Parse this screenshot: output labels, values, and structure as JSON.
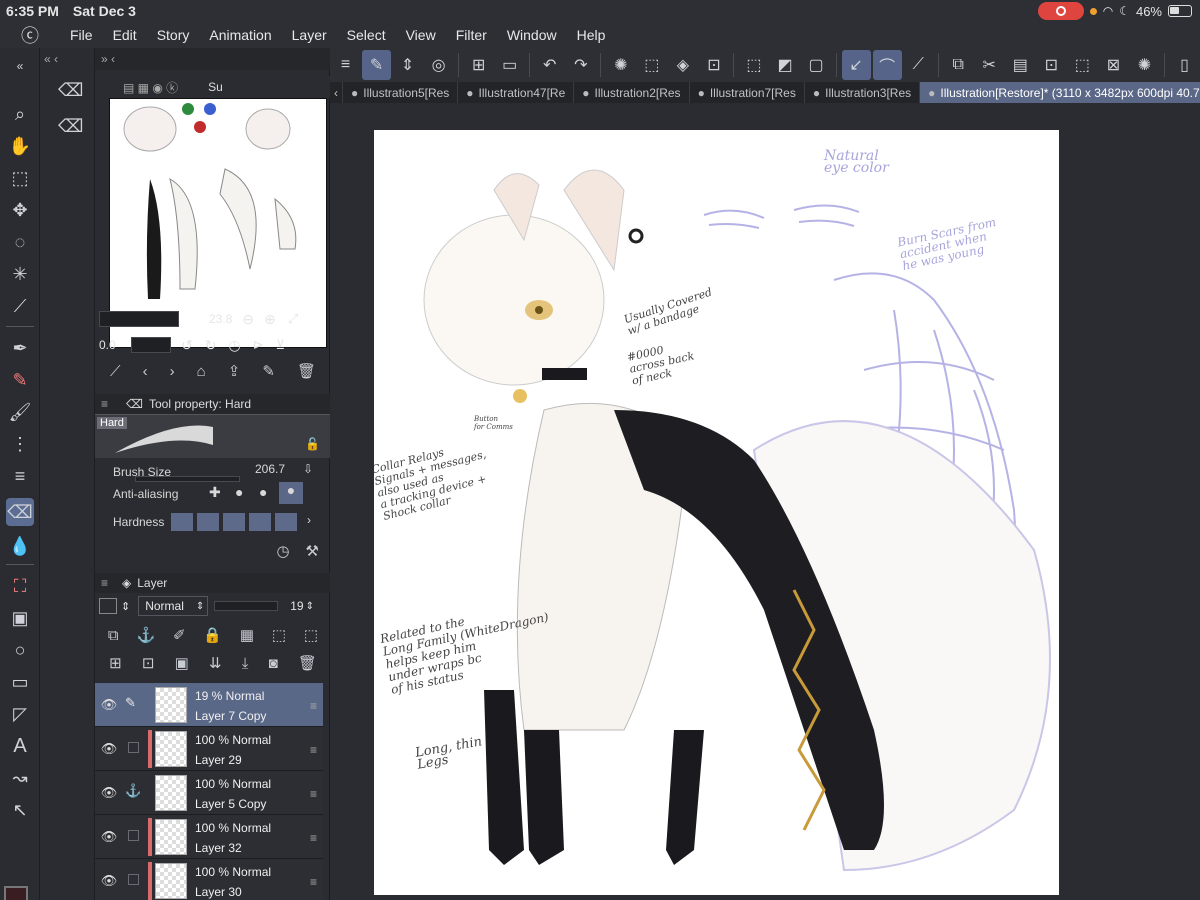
{
  "status": {
    "time": "6:35 PM",
    "date": "Sat Dec 3",
    "battery": "46%"
  },
  "menu": [
    "File",
    "Edit",
    "Story",
    "Animation",
    "Layer",
    "Select",
    "View",
    "Filter",
    "Window",
    "Help"
  ],
  "tabs": [
    {
      "label": "Illustration5[Res",
      "active": false
    },
    {
      "label": "Illustration47[Re",
      "active": false
    },
    {
      "label": "Illustration2[Res",
      "active": false
    },
    {
      "label": "Illustration7[Res",
      "active": false
    },
    {
      "label": "Illustration3[Res",
      "active": false
    },
    {
      "label": "Illustration[Restore]* (3110 x 3482px 600dpi 40.7%)",
      "active": true
    }
  ],
  "navigator": {
    "zoom": "23.8",
    "rotation": "0.0",
    "tab_short": "Su"
  },
  "tool_property": {
    "title": "Tool property: Hard",
    "preset": "Hard",
    "brush_size_label": "Brush Size",
    "brush_size": "206.7",
    "anti_aliasing_label": "Anti-aliasing",
    "hardness_label": "Hardness"
  },
  "layer_panel": {
    "title": "Layer",
    "blend_mode": "Normal",
    "opacity": "19",
    "layers": [
      {
        "mode": "19 %  Normal",
        "name": "Layer 7 Copy",
        "selected": true
      },
      {
        "mode": "100 %  Normal",
        "name": "Layer 29",
        "selected": false
      },
      {
        "mode": "100 %  Normal",
        "name": "Layer 5 Copy",
        "selected": false
      },
      {
        "mode": "100 %  Normal",
        "name": "Layer 32",
        "selected": false
      },
      {
        "mode": "100 %  Normal",
        "name": "Layer 30",
        "selected": false
      }
    ]
  },
  "canvas_notes": {
    "eye_color": "Natural\neye color",
    "burn_scars": "Burn Scars from\naccident when\nhe was young",
    "bandage": "Usually Covered\nw/ a bandage",
    "hex": "#0000\nacross back\nof neck",
    "collar": "Collar Relays\nSignals + messages,\nalso used as\na tracking device +\nShock collar",
    "legs": "Long, thin\nLegs",
    "related": "Related to the\nLong Family (WhiteDragon)\nhelps keep him\nunder wraps bc\nof his status",
    "button": "Button\nfor Comms"
  },
  "colors": {
    "accent": "#5a6786",
    "foreground_color": "#3a1d22",
    "background_color": "#ffffff"
  }
}
